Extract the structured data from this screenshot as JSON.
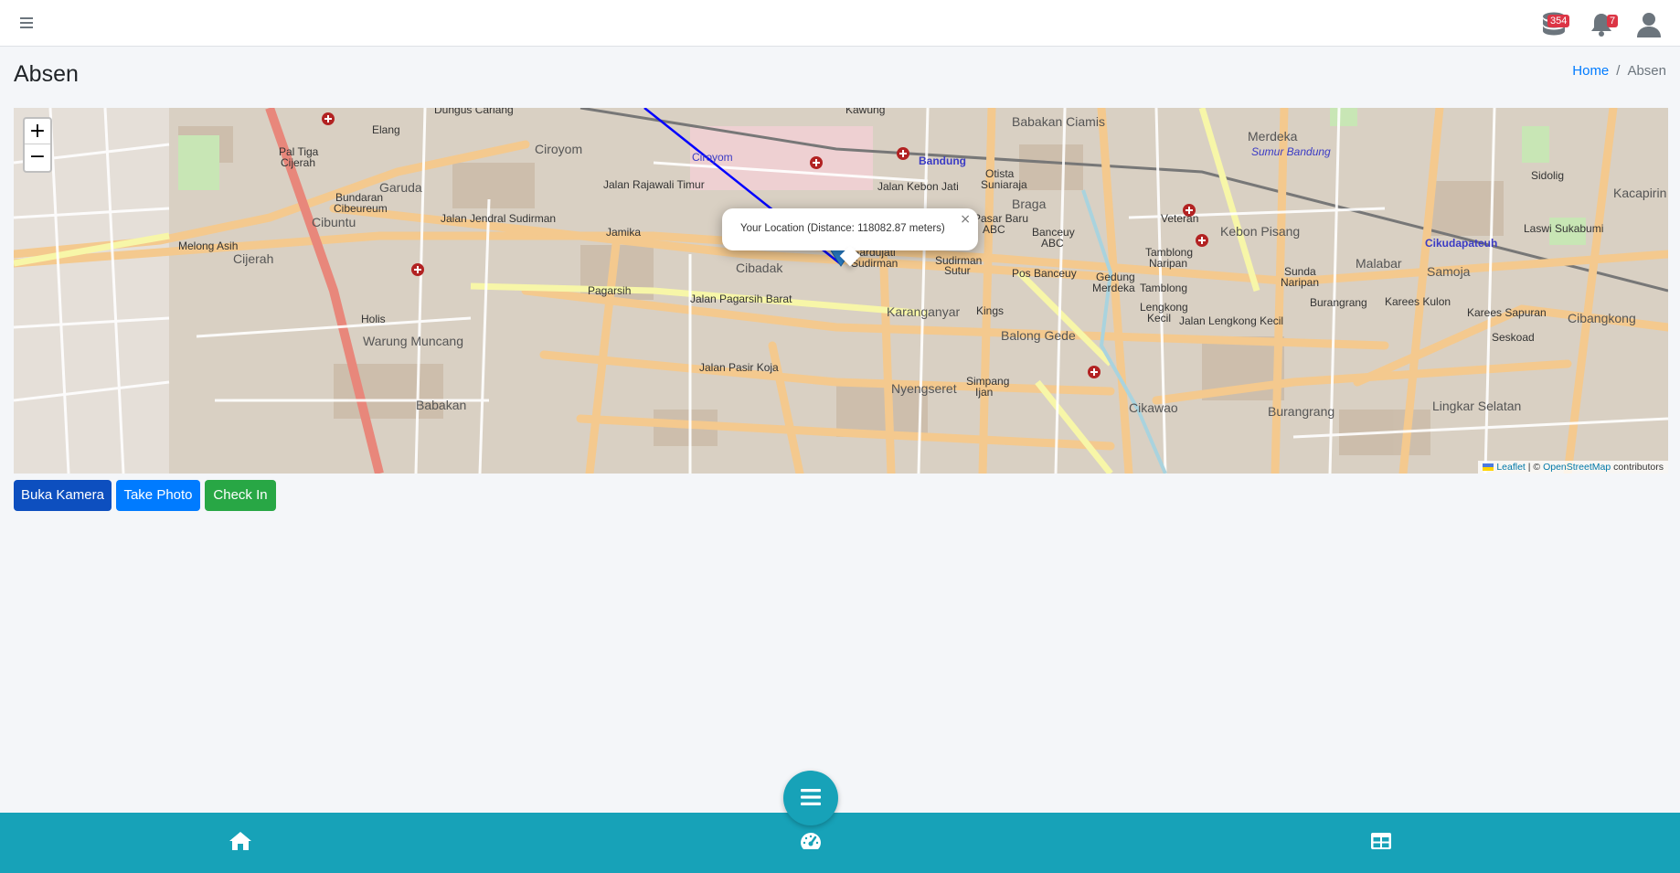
{
  "header": {
    "menu_icon": "bars-icon",
    "database_badge": "354",
    "notification_badge": "7",
    "user_icon": "user-icon"
  },
  "page": {
    "title": "Absen",
    "breadcrumb": [
      {
        "label": "Home"
      },
      {
        "label": "Absen"
      }
    ]
  },
  "map": {
    "zoom_in": "+",
    "zoom_out": "−",
    "popup_text": "Your Location (Distance: 118082.87 meters)",
    "popup_close": "×",
    "attribution": {
      "leaflet": "Leaflet",
      "separator": " | © ",
      "osm": "OpenStreetMap",
      "suffix": " contributors"
    },
    "labels": [
      "Dungus Cariang",
      "Kawung Paskal",
      "Babakan Ciamis",
      "Merdeka",
      "Ciroyom",
      "Bandung",
      "Garuda",
      "Otista Suniaraja",
      "Braga",
      "Jalan Kebon Jati",
      "Jalan Rajawali Timur",
      "Jalan Jendral Sudirman",
      "Cibuntu",
      "Cijerah",
      "Melong Asih",
      "Cibadak",
      "Jamika",
      "Gardujati Sudirman",
      "Sudirman Sutur",
      "Pasar Baru ABC",
      "Banceuy ABC",
      "Kebon Pisang",
      "Veteran",
      "Tamblong Naripan",
      "Sunda Naripan",
      "Malabar",
      "Samoja",
      "Cikudapateuh",
      "Kacapirin",
      "Sidolig",
      "Laswi Sukabumi",
      "Pagarsih",
      "Jalan Pagarsih Barat",
      "Karanganyar",
      "Kings",
      "Balong Gede",
      "Pos Banceuy",
      "Gedung Merdeka",
      "Lengkong Kecil",
      "Jalan Lengkong Kecil",
      "Burangrang",
      "Karees Kulon",
      "Karees Sapuran",
      "Cibangkong",
      "Seskoad",
      "Holis",
      "Warung Muncang",
      "Jalan Pasir Koja",
      "Nyengseret",
      "Simpang Ijan",
      "Babakan",
      "Cikawao",
      "Lingkar Selatan",
      "Sumur Bandung",
      "Pal Tiga Cijerah",
      "Bundaran Cibeureum",
      "Elang"
    ]
  },
  "actions": {
    "camera": "Buka Kamera",
    "photo": "Take Photo",
    "checkin": "Check In"
  },
  "bottom_nav": {
    "home_icon": "home-icon",
    "menu_icon": "bars-icon",
    "dashboard_icon": "gauge-icon",
    "table_icon": "table-icon"
  },
  "colors": {
    "primary": "#007bff",
    "camera_button": "#0d4fbf",
    "success": "#28a745",
    "bottom_bar": "#17a2b8",
    "badge": "#dc3545",
    "route_line": "#0000ff",
    "marker": "#2a81cb"
  }
}
